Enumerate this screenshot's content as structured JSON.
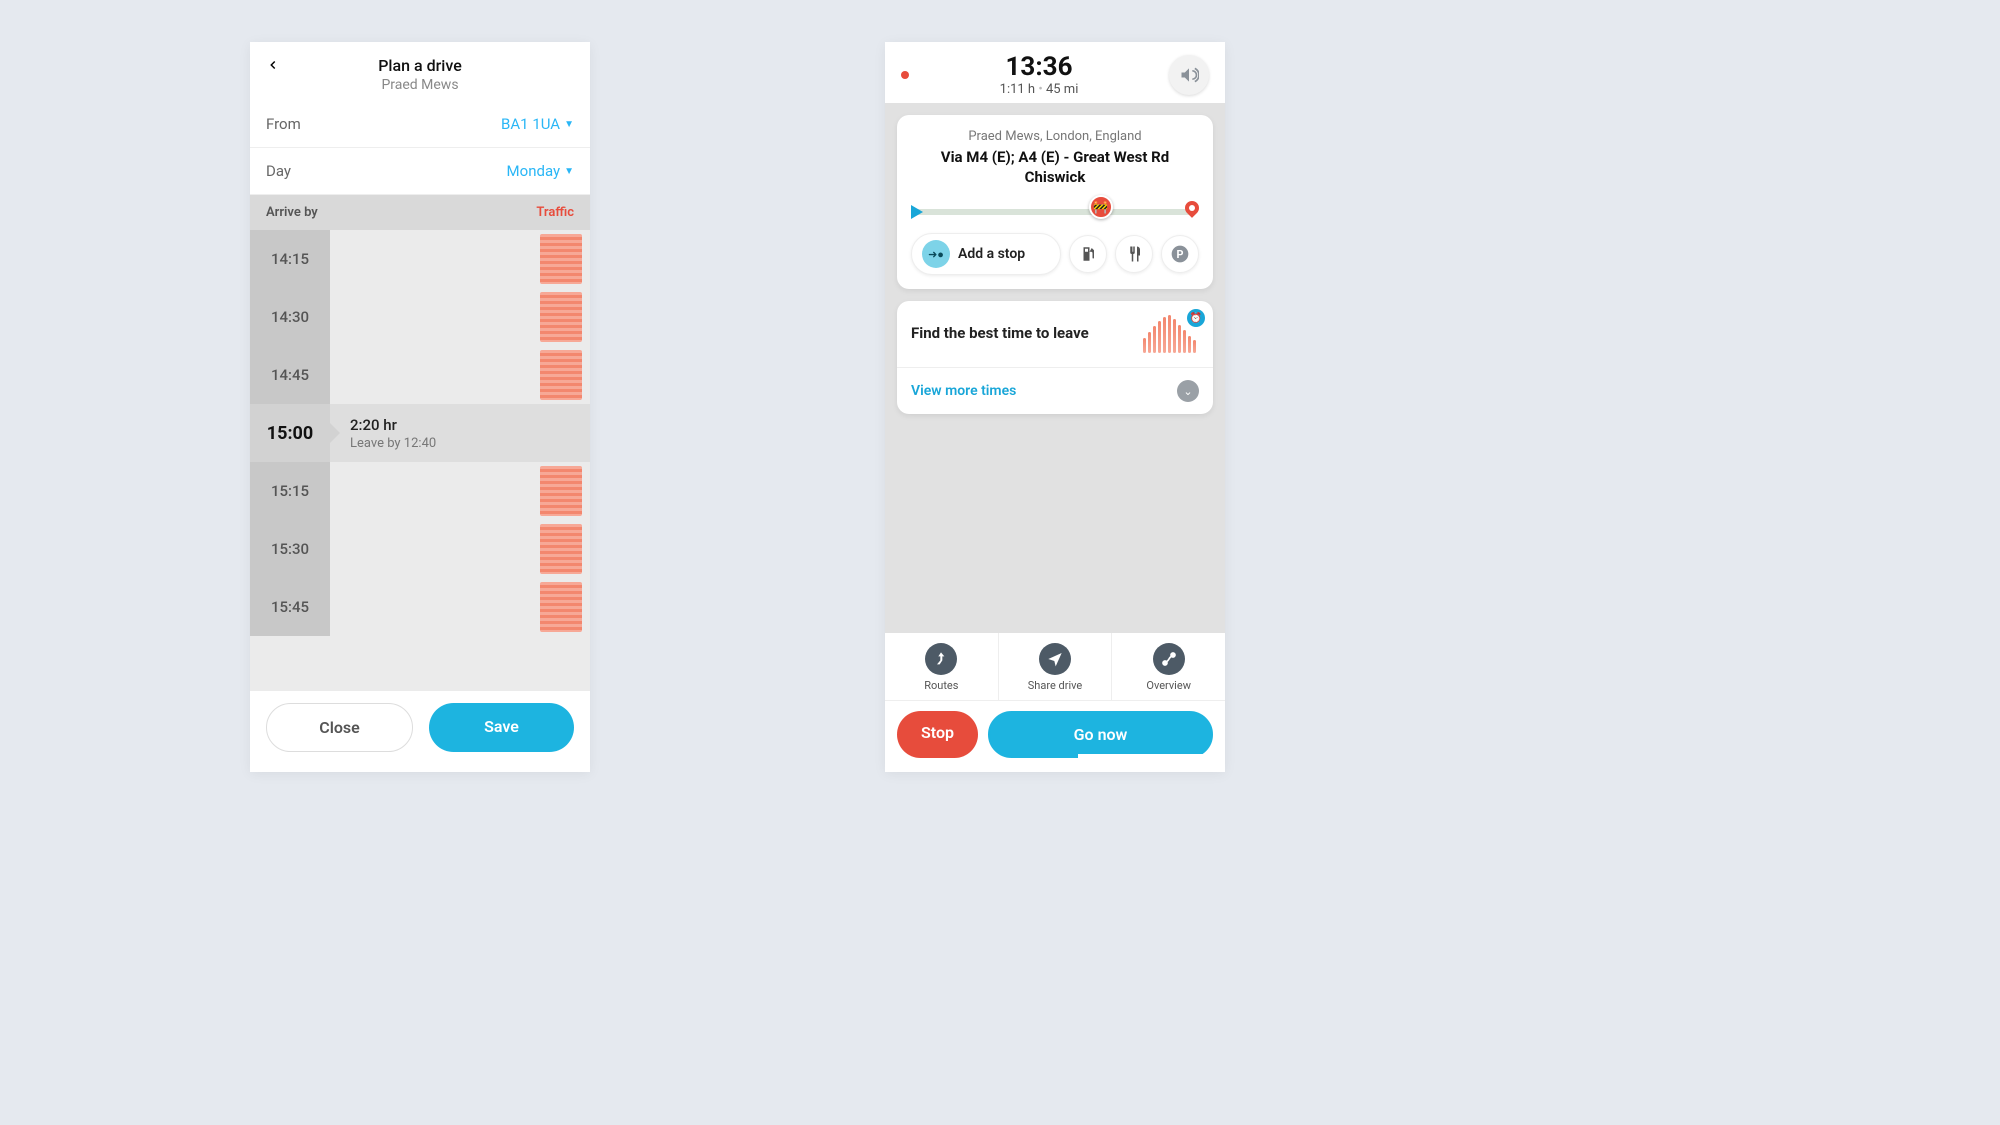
{
  "left": {
    "title": "Plan a drive",
    "subtitle": "Praed Mews",
    "from_label": "From",
    "from_value": "BA1 1UA",
    "day_label": "Day",
    "day_value": "Monday",
    "col_arrive": "Arrive by",
    "col_traffic": "Traffic",
    "times": [
      "14:15",
      "14:30",
      "14:45",
      "15:00",
      "15:15",
      "15:30",
      "15:45"
    ],
    "selected_index": 3,
    "selected_duration": "2:20 hr",
    "selected_leave": "Leave by 12:40",
    "close": "Close",
    "save": "Save"
  },
  "right": {
    "time": "13:36",
    "duration": "1:11 h",
    "distance": "45 mi",
    "dest": "Praed Mews, London, England",
    "via": "Via M4 (E); A4 (E) - Great West Rd Chiswick",
    "add_stop": "Add a stop",
    "best_time": "Find the best time to leave",
    "view_more": "View more times",
    "actions": {
      "routes": "Routes",
      "share": "Share drive",
      "overview": "Overview"
    },
    "stop": "Stop",
    "go": "Go now"
  }
}
